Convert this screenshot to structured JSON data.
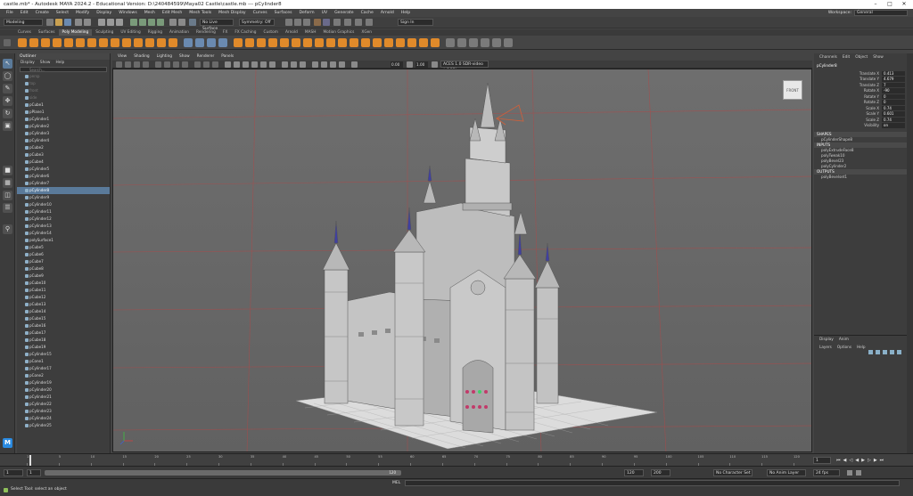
{
  "title": {
    "text": "castle.mb* - Autodesk MAYA 2024.2 - Educational Version: D:\\240484599\\Maya02 Castle\\castle.mb    ---    pCylinder8"
  },
  "menubar": {
    "items": [
      "File",
      "Edit",
      "Create",
      "Select",
      "Modify",
      "Display",
      "Windows",
      "Mesh",
      "Edit Mesh",
      "Mesh Tools",
      "Mesh Display",
      "Curves",
      "Surfaces",
      "Deform",
      "UV",
      "Generate",
      "Cache",
      "Arnold",
      "Help"
    ],
    "workspace_label": "Workspace:",
    "workspace_value": "General"
  },
  "statusline": {
    "mode": "Modeling",
    "live_surface": "No Live Surface",
    "symmetry": "Symmetry: Off",
    "sign_in": "Sign In"
  },
  "shelf": {
    "tabs": [
      "Curves",
      "Surfaces",
      "Poly Modeling",
      "Sculpting",
      "UV Editing",
      "Rigging",
      "Animation",
      "Rendering",
      "FX",
      "FX Caching",
      "Custom",
      "Arnold",
      "MASH",
      "Motion Graphics",
      "XGen"
    ],
    "active_tab": 2
  },
  "outliner": {
    "title": "Outliner",
    "menu": [
      "Display",
      "Show",
      "Help"
    ],
    "search_placeholder": "Search...",
    "items": [
      {
        "name": "persp",
        "dim": true
      },
      {
        "name": "top",
        "dim": true
      },
      {
        "name": "front",
        "dim": true
      },
      {
        "name": "side",
        "dim": true
      },
      {
        "name": "pCube1"
      },
      {
        "name": "pPlane1"
      },
      {
        "name": "pCylinder1"
      },
      {
        "name": "pCylinder2"
      },
      {
        "name": "pCylinder3"
      },
      {
        "name": "pCylinder4"
      },
      {
        "name": "pCube2"
      },
      {
        "name": "pCube3"
      },
      {
        "name": "pCube4"
      },
      {
        "name": "pCylinder5"
      },
      {
        "name": "pCylinder6"
      },
      {
        "name": "pCylinder7"
      },
      {
        "name": "pCylinder8",
        "selected": true
      },
      {
        "name": "pCylinder9"
      },
      {
        "name": "pCylinder10"
      },
      {
        "name": "pCylinder11"
      },
      {
        "name": "pCylinder12"
      },
      {
        "name": "pCylinder13"
      },
      {
        "name": "pCylinder14"
      },
      {
        "name": "polySurface1"
      },
      {
        "name": "pCube5"
      },
      {
        "name": "pCube6"
      },
      {
        "name": "pCube7"
      },
      {
        "name": "pCube8"
      },
      {
        "name": "pCube9"
      },
      {
        "name": "pCube10"
      },
      {
        "name": "pCube11"
      },
      {
        "name": "pCube12"
      },
      {
        "name": "pCube13"
      },
      {
        "name": "pCube14"
      },
      {
        "name": "pCube15"
      },
      {
        "name": "pCube16"
      },
      {
        "name": "pCube17"
      },
      {
        "name": "pCube18"
      },
      {
        "name": "pCube19"
      },
      {
        "name": "pCylinder15"
      },
      {
        "name": "pCone1"
      },
      {
        "name": "pCylinder17"
      },
      {
        "name": "pCone2"
      },
      {
        "name": "pCylinder19"
      },
      {
        "name": "pCylinder20"
      },
      {
        "name": "pCylinder21"
      },
      {
        "name": "pCylinder22"
      },
      {
        "name": "pCylinder23"
      },
      {
        "name": "pCylinder24"
      },
      {
        "name": "pCylinder25"
      }
    ]
  },
  "viewport": {
    "menu": [
      "View",
      "Shading",
      "Lighting",
      "Show",
      "Renderer",
      "Panels"
    ],
    "value_a": "0.00",
    "value_b": "1.00",
    "colorspace": "ACES 1.0 SDR-video (sRGB)",
    "viewcube_label": "FRONT"
  },
  "channelbox": {
    "tabs": [
      "Channels",
      "Edit",
      "Object",
      "Show"
    ],
    "object_name": "pCylinder8",
    "attributes": [
      {
        "label": "Translate X",
        "value": "0.413"
      },
      {
        "label": "Translate Y",
        "value": "4.679"
      },
      {
        "label": "Translate Z",
        "value": "7"
      },
      {
        "label": "Rotate X",
        "value": "-90"
      },
      {
        "label": "Rotate Y",
        "value": "0"
      },
      {
        "label": "Rotate Z",
        "value": "0"
      },
      {
        "label": "Scale X",
        "value": "0.74"
      },
      {
        "label": "Scale Y",
        "value": "0.601"
      },
      {
        "label": "Scale Z",
        "value": "0.74"
      },
      {
        "label": "Visibility",
        "value": "on"
      }
    ],
    "shapes_label": "SHAPES",
    "shape": "pCylinderShape8",
    "inputs_label": "INPUTS",
    "inputs": [
      "polyExtrudeFace8",
      "polyTweak10",
      "polyBevel23",
      "polyCylinder2"
    ],
    "outputs_label": "OUTPUTS",
    "outputs": [
      "polyBevelset1"
    ]
  },
  "layers": {
    "tabs": [
      "Display",
      "Anim"
    ],
    "menu": [
      "Layers",
      "Options",
      "Help"
    ]
  },
  "timeline": {
    "ticks": [
      "1",
      "5",
      "10",
      "15",
      "20",
      "25",
      "30",
      "35",
      "40",
      "45",
      "50",
      "55",
      "60",
      "65",
      "70",
      "75",
      "80",
      "85",
      "90",
      "95",
      "100",
      "105",
      "110",
      "115",
      "120"
    ],
    "current_frame": "1",
    "start": "1",
    "range_start": "1",
    "range_end": "120",
    "end": "120",
    "end2": "200",
    "character_set": "No Character Set",
    "anim_layer": "No Anim Layer",
    "fps": "24 fps"
  },
  "helpline": {
    "mel_label": "MEL",
    "status": "Select Tool: select an object"
  },
  "colors": {
    "accent_orange": "#e08a2a",
    "selection_blue": "#5a7a9a"
  }
}
